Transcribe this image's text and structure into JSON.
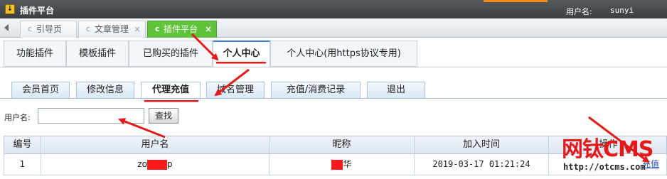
{
  "titlebar": {
    "icon_glyph": "↓",
    "title": "插件平台",
    "user_label": "用户名:",
    "user_value": "sunyi"
  },
  "window_tabs": [
    {
      "icon": "refresh-icon",
      "icon_glyph": "c",
      "label": "引导页"
    },
    {
      "icon": "refresh-icon",
      "icon_glyph": "c",
      "label": "文章管理",
      "close": "×"
    },
    {
      "icon": "refresh-icon",
      "icon_glyph": "c",
      "label": "插件平台",
      "close": "×",
      "active": true
    }
  ],
  "main_nav": [
    {
      "label": "功能插件"
    },
    {
      "label": "模板插件"
    },
    {
      "label": "已购买的插件"
    },
    {
      "label": "个人中心",
      "active": true
    },
    {
      "label": "个人中心(用https协议专用)"
    }
  ],
  "sub_nav": [
    {
      "label": "会员首页"
    },
    {
      "label": "修改信息"
    },
    {
      "label": "代理充值",
      "active": true
    },
    {
      "label": "域名管理"
    },
    {
      "label": "充值/消费记录"
    },
    {
      "label": "退出"
    }
  ],
  "search": {
    "label": "用户名:",
    "value": "",
    "button_label": "查找"
  },
  "table": {
    "columns": [
      "编号",
      "用户名",
      "昵称",
      "加入时间",
      "操作"
    ],
    "rows": [
      {
        "id": "1",
        "username_prefix": "zo",
        "username_suffix": "p",
        "nickname_suffix": "华",
        "joined": "2019-03-17 01:21:24",
        "action": "充值"
      }
    ]
  },
  "watermark": {
    "title": "网钛CMS",
    "url": "http://otcms.com"
  },
  "colors": {
    "annotation_red": "#e3191a",
    "active_tab_green": "#5ec33a",
    "titlebar_dark": "#3a3e41"
  }
}
